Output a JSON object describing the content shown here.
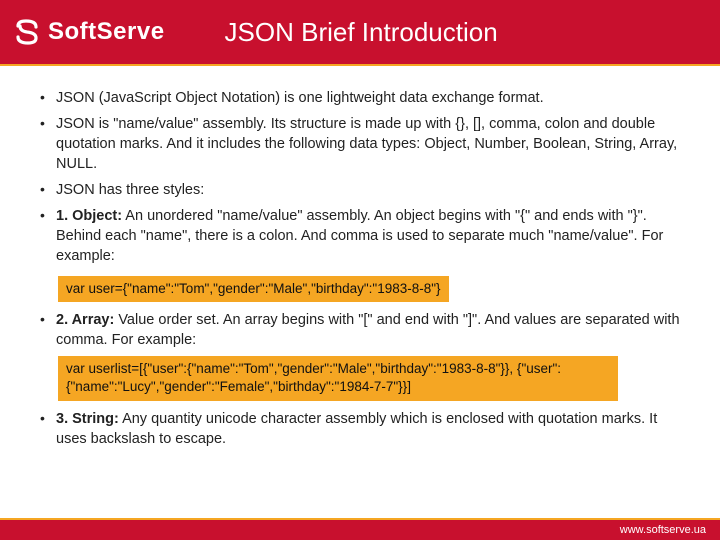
{
  "header": {
    "brand": "SoftServe",
    "title": "JSON Brief Introduction"
  },
  "bullets": {
    "b1": "JSON (JavaScript Object Notation) is one lightweight data exchange format.",
    "b2": "JSON is \"name/value\" assembly. Its structure is made up with {}, [], comma, colon and double quotation marks. And it includes the following data types: Object, Number, Boolean, String, Array, NULL.",
    "b3": "JSON has three styles:",
    "b4_bold": "1. Object:",
    "b4_rest": " An unordered \"name/value\" assembly. An object begins with \"{\" and ends with \"}\". Behind each \"name\", there is a colon. And comma is used to separate much \"name/value\". For example:",
    "b5_bold": "2. Array:",
    "b5_rest": " Value order set. An array begins with \"[\" and end with \"]\". And values are separated with comma. For example:",
    "b6_bold": "3. String:",
    "b6_rest": " Any quantity unicode character assembly which is enclosed with quotation marks. It uses backslash to escape."
  },
  "code": {
    "c1": "var user={\"name\":\"Tom\",\"gender\":\"Male\",\"birthday\":\"1983-8-8\"}",
    "c2": "var userlist=[{\"user\":{\"name\":\"Tom\",\"gender\":\"Male\",\"birthday\":\"1983-8-8\"}}, {\"user\":{\"name\":\"Lucy\",\"gender\":\"Female\",\"birthday\":\"1984-7-7\"}}]"
  },
  "footer": {
    "url": "www.softserve.ua"
  }
}
